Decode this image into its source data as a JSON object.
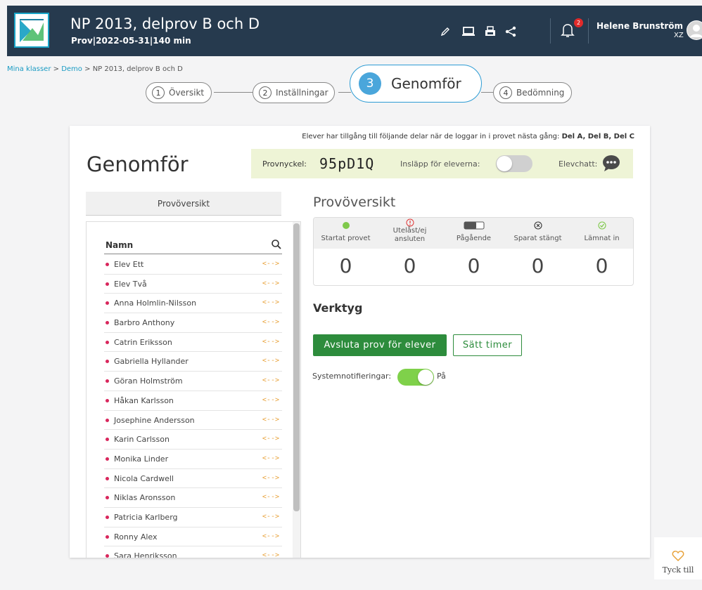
{
  "header": {
    "title": "NP 2013, delprov B och D",
    "subtitle": "Prov|2022-05-31|140 min",
    "notification_count": "2",
    "user_name": "Helene Brunström",
    "user_initials": "XZ",
    "icons": [
      "pencil-icon",
      "laptop-icon",
      "print-icon",
      "share-icon",
      "bell-icon",
      "avatar-icon"
    ]
  },
  "breadcrumb": {
    "items": [
      "Mina klasser",
      "Demo",
      "NP 2013, delprov B och D"
    ],
    "separator": ">"
  },
  "stepper": {
    "steps": [
      {
        "num": "1",
        "label": "Översikt"
      },
      {
        "num": "2",
        "label": "Inställningar"
      },
      {
        "num": "3",
        "label": "Genomför"
      },
      {
        "num": "4",
        "label": "Bedömning"
      }
    ],
    "active_index": 2
  },
  "card": {
    "access_note_prefix": "Elever har tillgång till följande delar när de loggar in i provet nästa gång:",
    "access_note_parts": "Del A, Del B, Del C",
    "title": "Genomför",
    "key_label": "Provnyckel:",
    "key_value": "95pD1Q",
    "insl_label": "Insläpp för eleverna:",
    "insl_state": "off",
    "chat_label": "Elevchatt:"
  },
  "student_list": {
    "tab_label": "Provöversikt",
    "column_name": "Namn",
    "status_color": "#d9265c",
    "action_glyph": "<-->",
    "students": [
      "Elev Ett",
      "Elev Två",
      "Anna Holmlin-Nilsson",
      "Barbro Anthony",
      "Catrin Eriksson",
      "Gabriella Hyllander",
      "Göran Holmström",
      "Håkan Karlsson",
      "Josephine Andersson",
      "Karin Carlsson",
      "Monika Linder",
      "Nicola Cardwell",
      "Niklas Aronsson",
      "Patricia Karlberg",
      "Ronny Alex",
      "Sara Henriksson"
    ]
  },
  "overview": {
    "title": "Provöversikt",
    "columns": [
      {
        "label": "Startat provet",
        "value": "0",
        "icon": "green-dot-icon"
      },
      {
        "label": "Utelåst/ej ansluten",
        "value": "0",
        "icon": "warning-icon"
      },
      {
        "label": "Pågående",
        "value": "0",
        "icon": "toggle-icon"
      },
      {
        "label": "Sparat stängt",
        "value": "0",
        "icon": "closed-circle-icon"
      },
      {
        "label": "Lämnat in",
        "value": "0",
        "icon": "check-circle-icon"
      }
    ]
  },
  "tools": {
    "title": "Verktyg",
    "end_button": "Avsluta prov för elever",
    "timer_button": "Sätt timer",
    "sys_label": "Systemnotifieringar:",
    "sys_state": "På"
  },
  "feedback": {
    "label": "Tyck till"
  },
  "colors": {
    "header_bg": "#263a4e",
    "accent_blue": "#4aa6db",
    "green": "#2d8c3c",
    "toggle_on": "#7fd14a",
    "key_bar": "#eef4d6",
    "link": "#1a9bc3"
  }
}
